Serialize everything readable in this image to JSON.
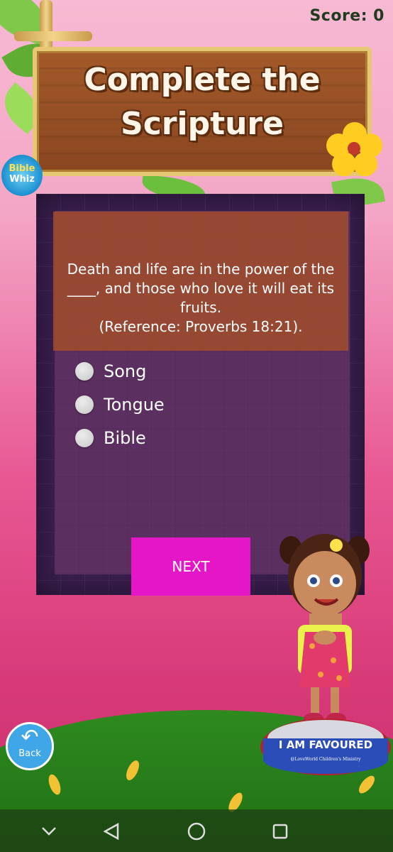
{
  "header": {
    "score_text": "Score: 0",
    "title": "Complete the\nScripture",
    "logo_line1": "Bible",
    "logo_line2": "Whiz"
  },
  "quiz": {
    "question": "Death and life are in the power of the ____, and those who love it will eat its fruits.\n(Reference: Proverbs 18:21).",
    "options": [
      {
        "label": "Song",
        "selected": false
      },
      {
        "label": "Tongue",
        "selected": false
      },
      {
        "label": "Bible",
        "selected": false
      }
    ],
    "next_label": "NEXT"
  },
  "footer": {
    "back_label": "Back",
    "badge_text": "I AM FAVOURED",
    "badge_subtext": "@LoveWorld Children's Ministry"
  },
  "colors": {
    "next_button": "#e416c8",
    "background_pink": "#e85a93",
    "panel_purple": "#5b2f5f",
    "question_box": "#a54e28",
    "score_text": "#1f3a1f"
  },
  "nav": {
    "icons": [
      "chevron-down-icon",
      "nav-back-icon",
      "nav-home-icon",
      "nav-recents-icon"
    ]
  }
}
